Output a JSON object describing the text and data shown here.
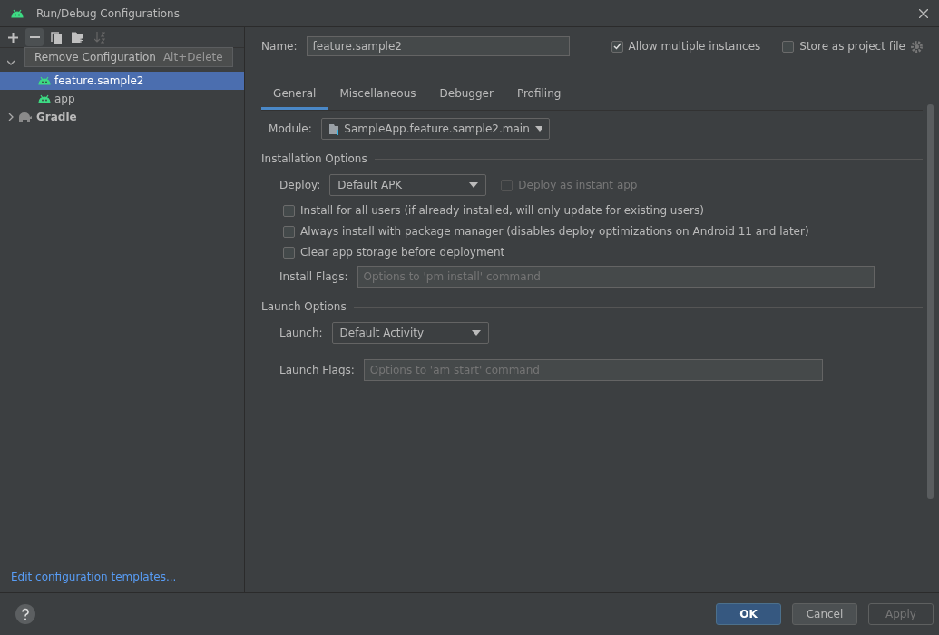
{
  "window": {
    "title": "Run/Debug Configurations"
  },
  "toolbar": [
    {
      "kind": "add",
      "disabled": false,
      "selected": false
    },
    {
      "kind": "remove",
      "disabled": false,
      "selected": true
    },
    {
      "kind": "copy",
      "disabled": false,
      "selected": false
    },
    {
      "kind": "folder",
      "disabled": false,
      "selected": false
    },
    {
      "kind": "sort",
      "disabled": true,
      "selected": false
    }
  ],
  "tooltip": {
    "label": "Remove Configuration",
    "shortcut": "Alt+Delete"
  },
  "tree": [
    {
      "kind": "group",
      "expanded": true,
      "children": [
        {
          "label": "feature.sample2",
          "kind": "android",
          "selected": true
        },
        {
          "label": "app",
          "kind": "android",
          "selected": false
        }
      ]
    },
    {
      "label": "Gradle",
      "kind": "gradle",
      "expanded": false
    }
  ],
  "edit_templates_link": "Edit configuration templates...",
  "name": {
    "label": "Name:",
    "value": "feature.sample2"
  },
  "options": [
    {
      "label": "Allow multiple instances",
      "checked": true
    },
    {
      "label": "Store as project file",
      "checked": false
    }
  ],
  "tabs": [
    {
      "label": "General",
      "selected": true
    },
    {
      "label": "Miscellaneous",
      "selected": false
    },
    {
      "label": "Debugger",
      "selected": false
    },
    {
      "label": "Profiling",
      "selected": false
    }
  ],
  "module": {
    "label": "Module:",
    "value": "SampleApp.feature.sample2.main"
  },
  "installation": {
    "title": "Installation Options",
    "deploy_label": "Deploy:",
    "deploy_value": "Default APK",
    "instant": {
      "label": "Deploy as instant app",
      "checked": false,
      "disabled": true
    },
    "checks": [
      {
        "label": "Install for all users (if already installed, will only update for existing users)",
        "checked": false
      },
      {
        "label": "Always install with package manager (disables deploy optimizations on Android 11 and later)",
        "checked": false
      },
      {
        "label": "Clear app storage before deployment",
        "checked": false
      }
    ],
    "flags_label": "Install Flags:",
    "flags_placeholder": "Options to 'pm install' command"
  },
  "launch": {
    "title": "Launch Options",
    "launch_label": "Launch:",
    "launch_value": "Default Activity",
    "flags_label": "Launch Flags:",
    "flags_placeholder": "Options to 'am start' command"
  },
  "buttons": [
    {
      "label": "OK",
      "kind": "default",
      "disabled": false
    },
    {
      "label": "Cancel",
      "kind": "normal",
      "disabled": false
    },
    {
      "label": "Apply",
      "kind": "normal",
      "disabled": true
    }
  ]
}
